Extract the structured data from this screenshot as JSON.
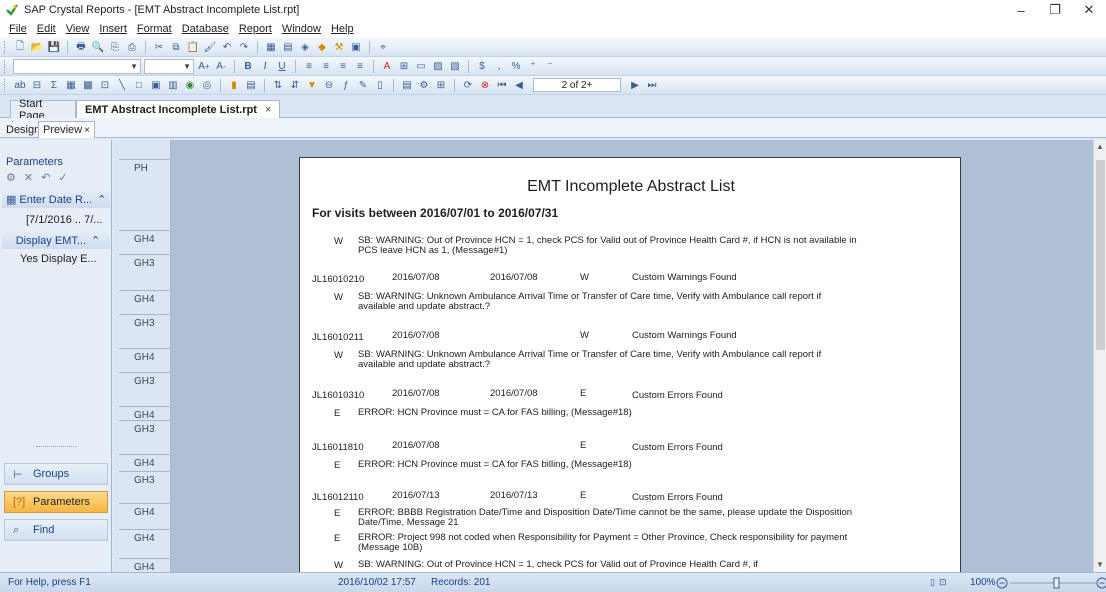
{
  "window": {
    "title": "SAP Crystal Reports - [EMT Abstract Incomplete List.rpt]",
    "controls": [
      "–",
      "❐",
      "✕"
    ]
  },
  "menu": [
    "File",
    "Edit",
    "View",
    "Insert",
    "Format",
    "Database",
    "Report",
    "Window",
    "Help"
  ],
  "toolbar": {
    "page_indicator": "2 of 2+"
  },
  "doc_tabs": {
    "start": "Start Page",
    "active": "EMT Abstract Incomplete List.rpt",
    "close": "×"
  },
  "view_tabs": {
    "design": "Design",
    "preview": "Preview",
    "close": "×"
  },
  "left_panel": {
    "title": "Parameters",
    "node1": "Enter Date R...",
    "node1_value": "[7/1/2016 .. 7/...",
    "node2": "Display EMT...",
    "node2_value": "Yes Display E...",
    "buttons": {
      "groups": "Groups",
      "parameters": "Parameters",
      "find": "Find"
    }
  },
  "sections": [
    "PH",
    "GH4",
    "GH3",
    "GH4",
    "GH3",
    "GH4",
    "GH3",
    "GH4",
    "GH3",
    "GH4",
    "GH3",
    "GH4",
    "GH4",
    "GH4"
  ],
  "report": {
    "title": "EMT Incomplete Abstract List",
    "subtitle": "For visits between 2016/07/01 to 2016/07/31",
    "first_msg": {
      "code": "W",
      "text": "SB: WARNING: Out of Province HCN = 1, check PCS for Valid out of Province Health Card #, if HCN is not available in PCS leave HCN as 1, (Message#1)"
    },
    "records": [
      {
        "id": "JL16010210",
        "date1": "2016/07/08",
        "date2": "2016/07/08",
        "flag": "W",
        "status": "Custom Warnings Found",
        "messages": [
          {
            "code": "W",
            "text": "SB: WARNING: Unknown Ambulance Arrival Time or Transfer of Care time, Verify with Ambulance call report if available and update abstract.?"
          }
        ]
      },
      {
        "id": "JL16010211",
        "date1": "2016/07/08",
        "date2": "",
        "flag": "W",
        "status": "Custom Warnings Found",
        "messages": [
          {
            "code": "W",
            "text": "SB: WARNING: Unknown Ambulance Arrival Time or Transfer of Care time, Verify with Ambulance call report if available and update abstract.?"
          }
        ]
      },
      {
        "id": "JL16010310",
        "date1": "2016/07/08",
        "date2": "2016/07/08",
        "flag": "E",
        "status": "Custom Errors Found",
        "messages": [
          {
            "code": "E",
            "text": "ERROR: HCN Province must = CA for FAS billing, (Message#18)"
          }
        ]
      },
      {
        "id": "JL16011810",
        "date1": "2016/07/08",
        "date2": "",
        "flag": "E",
        "status": "Custom Errors Found",
        "messages": [
          {
            "code": "E",
            "text": "ERROR: HCN Province must = CA for FAS billing, (Message#18)"
          }
        ]
      },
      {
        "id": "JL16012110",
        "date1": "2016/07/13",
        "date2": "2016/07/13",
        "flag": "E",
        "status": "Custom Errors Found",
        "messages": [
          {
            "code": "E",
            "text": "ERROR: BBBB Registration Date/Time and Disposition Date/Time cannot be the same, please update the Disposition Date/Time, Message 21"
          },
          {
            "code": "E",
            "text": "ERROR: Project 998 not coded when Responsibility for Payment = Other Province, Check responsibility for payment (Message 10B)"
          },
          {
            "code": "W",
            "text": "SB: WARNING: Out of Province HCN = 1, check PCS for Valid out of Province Health Card #, if"
          }
        ]
      }
    ]
  },
  "status": {
    "help": "For Help, press F1",
    "datetime": "2016/10/02 17:57",
    "records": "Records: 201",
    "zoom": "100%"
  }
}
